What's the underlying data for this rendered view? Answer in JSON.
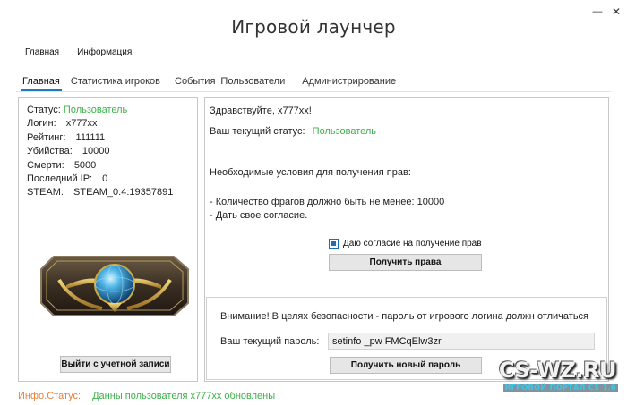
{
  "window": {
    "title": "Игровой лаунчер",
    "minimize_glyph": "—",
    "close_glyph": "✕"
  },
  "menu": [
    "Главная",
    "Информация"
  ],
  "tabs": [
    "Главная",
    "Статистика игроков",
    "События",
    "Пользователи",
    "Администрирование"
  ],
  "profile": {
    "status_label": "Статус:",
    "status_value": "Пользователь",
    "login_label": "Логин:",
    "login_value": "x777xx",
    "rating_label": "Рейтинг:",
    "rating_value": "111111",
    "kills_label": "Убийства:",
    "kills_value": "10000",
    "deaths_label": "Смерти:",
    "deaths_value": "5000",
    "ip_label": "Последний IP:",
    "ip_value": "0",
    "steam_label": "STEAM:",
    "steam_value": "STEAM_0:4:19357891",
    "badge_icon": "global-elite-badge-icon",
    "logout_label": "Выйти с учетной записи"
  },
  "main": {
    "greeting": "Здравствуйте,  x777xx!",
    "current_status_label": "Ваш текущий статус:",
    "current_status_value": "Пользователь",
    "requirements_title": "Необходимые условия для получения прав:",
    "requirement_1": "- Количество фрагов должно быть не менее: 10000",
    "requirement_2": "- Дать свое согласие.",
    "consent_label": "Даю согласие на получение прав",
    "get_rights_label": "Получить права"
  },
  "security": {
    "warning": "Внимание! В целях безопасности - пароль от игрового логина должн отличаться",
    "password_label": "Ваш текущий пароль:",
    "password_value": "setinfo _pw FMCqElw3zr",
    "new_password_label": "Получить новый пароль"
  },
  "statusbar": {
    "label": "Инфо.Статус:",
    "message": "Данны пользователя x777xx обновлены"
  },
  "watermark": {
    "main": "CS-WZ.RU",
    "sub": "ИГРОВОЙ ПОРТАЛ CS 1.6"
  },
  "colors": {
    "green": "#3cb04a",
    "red": "#e0334a",
    "orange": "#e8803a",
    "accent": "#1e78c8"
  }
}
